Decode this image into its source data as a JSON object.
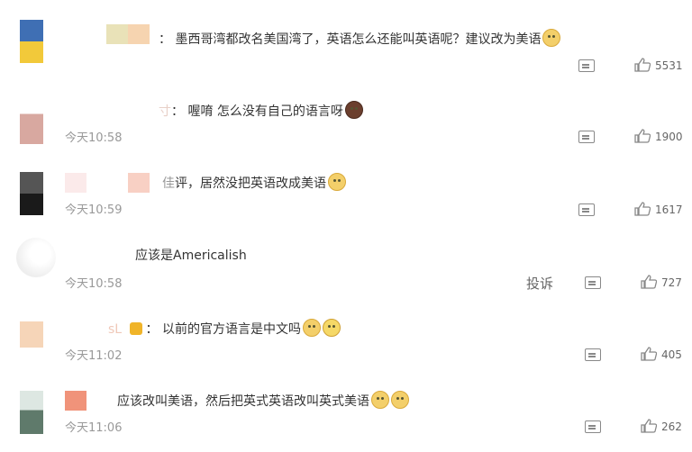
{
  "comments": [
    {
      "text": "墨西哥湾都改名美国湾了，英语怎么还能叫英语呢？建议改为美语",
      "time": "",
      "likes": "5531"
    },
    {
      "name_tail": "寸",
      "text": "喔唷 怎么没有自己的语言呀",
      "time": "今天10:58",
      "likes": "1900"
    },
    {
      "name_tail": "佳",
      "text": "评，居然没把英语改成美语",
      "time": "今天10:59",
      "likes": "1617"
    },
    {
      "text": "应该是Americalish",
      "time": "今天10:58",
      "likes": "727",
      "report_label": "投诉"
    },
    {
      "name_tail": "sL",
      "text": "以前的官方语言是中文吗",
      "time": "今天11:02",
      "likes": "405"
    },
    {
      "text": "应该改叫美语，然后把英式英语改叫英式美语",
      "time": "今天11:06",
      "likes": "262"
    }
  ],
  "separator": "：",
  "icons": [
    "comment-icon",
    "like-icon",
    "emoji-icon",
    "crown-icon"
  ]
}
